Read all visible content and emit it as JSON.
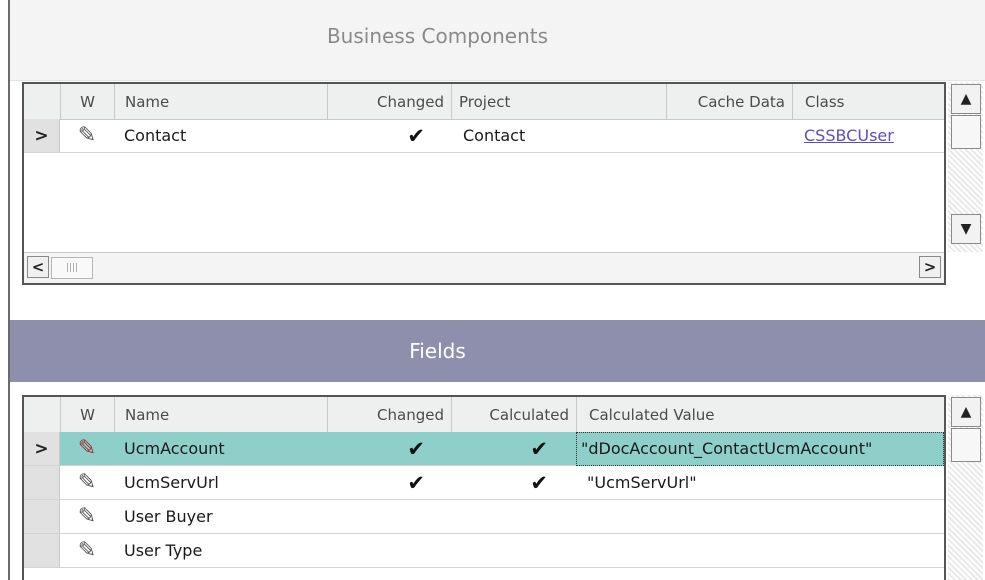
{
  "business_components": {
    "title": "Business Components",
    "columns": [
      "W",
      "Name",
      "Changed",
      "Project",
      "Cache Data",
      "Class"
    ],
    "rows": [
      {
        "name": "Contact",
        "changed": "✔",
        "project": "Contact",
        "cache_data": "",
        "class": "CSSBCUser"
      }
    ]
  },
  "fields": {
    "title": "Fields",
    "columns": [
      "W",
      "Name",
      "Changed",
      "Calculated",
      "Calculated Value"
    ],
    "rows": [
      {
        "name": "UcmAccount",
        "changed": "✔",
        "calculated": "✔",
        "calculated_value": "\"dDocAccount_ContactUcmAccount\""
      },
      {
        "name": "UcmServUrl",
        "changed": "✔",
        "calculated": "✔",
        "calculated_value": "\"UcmServUrl\""
      },
      {
        "name": "User Buyer",
        "changed": "",
        "calculated": "",
        "calculated_value": ""
      },
      {
        "name": "User Type",
        "changed": "",
        "calculated": "",
        "calculated_value": ""
      }
    ]
  },
  "icons": {
    "current_row": "chevron-right-icon",
    "pencil": "pencil-icon",
    "scroll_up": "arrow-up-icon",
    "scroll_down": "arrow-down-icon",
    "scroll_left": "arrow-left-icon",
    "scroll_right": "arrow-right-icon"
  },
  "colors": {
    "selected_row": "#8fcfc9",
    "section_band": "#8d8fad",
    "link": "#5b4fc0"
  }
}
